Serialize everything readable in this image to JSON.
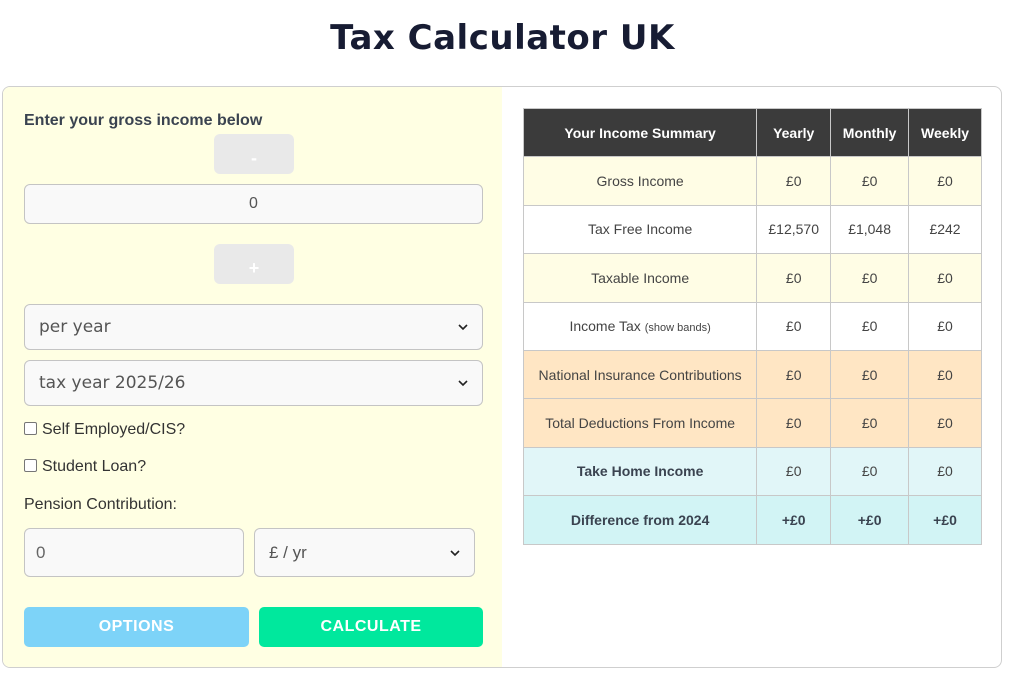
{
  "page": {
    "title": "Tax Calculator UK"
  },
  "form": {
    "prompt": "Enter your gross income below",
    "minus_label": "-",
    "plus_label": "+",
    "income_value": "0",
    "period_selected": "per year",
    "tax_year_selected": "tax year 2025/26",
    "self_employed_label": "Self Employed/CIS?",
    "student_loan_label": "Student Loan?",
    "pension_label": "Pension Contribution:",
    "pension_value": "0",
    "pension_unit_selected": "£ / yr",
    "options_label": "OPTIONS",
    "calculate_label": "CALCULATE"
  },
  "summary": {
    "headers": [
      "Your Income Summary",
      "Yearly",
      "Monthly",
      "Weekly"
    ],
    "rows": [
      {
        "label": "Gross Income",
        "yearly": "£0",
        "monthly": "£0",
        "weekly": "£0"
      },
      {
        "label": "Tax Free Income",
        "yearly": "£12,570",
        "monthly": "£1,048",
        "weekly": "£242"
      },
      {
        "label": "Taxable Income",
        "yearly": "£0",
        "monthly": "£0",
        "weekly": "£0"
      },
      {
        "label": "Income Tax",
        "sublabel": "(show bands)",
        "yearly": "£0",
        "monthly": "£0",
        "weekly": "£0"
      },
      {
        "label": "National Insurance Contributions",
        "yearly": "£0",
        "monthly": "£0",
        "weekly": "£0"
      },
      {
        "label": "Total Deductions From Income",
        "yearly": "£0",
        "monthly": "£0",
        "weekly": "£0"
      },
      {
        "label": "Take Home Income",
        "yearly": "£0",
        "monthly": "£0",
        "weekly": "£0"
      },
      {
        "label": "Difference from 2024",
        "yearly": "+£0",
        "monthly": "+£0",
        "weekly": "+£0"
      }
    ]
  },
  "colors": {
    "left_panel_bg": "#ffffe3",
    "header_bg": "#3b3b3b",
    "options_button": "#7dd3f8",
    "calculate_button": "#00e89d",
    "ni_row_bg": "#ffe6c4",
    "take_home_bg": "#e1f6f8"
  },
  "icons": {
    "select_arrow": "chevron-down-icon"
  }
}
